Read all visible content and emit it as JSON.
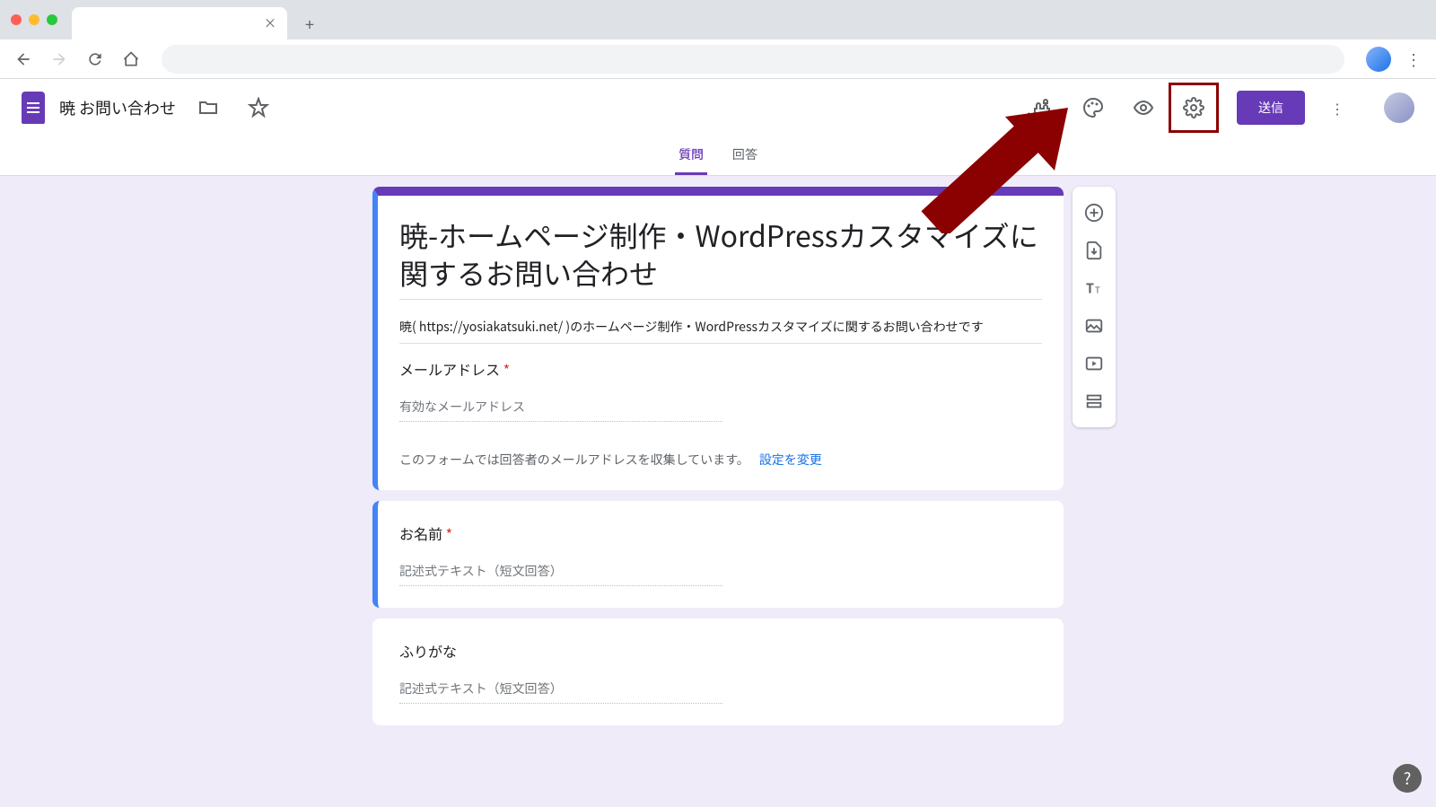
{
  "browser": {
    "tab_title": "",
    "tab_close": "×",
    "new_tab": "+"
  },
  "header": {
    "title": "暁 お問い合わせ",
    "send_label": "送信"
  },
  "tabs": {
    "questions": "質問",
    "responses": "回答"
  },
  "form": {
    "title": "暁-ホームページ制作・WordPressカスタマイズに関するお問い合わせ",
    "description": "暁( https://yosiakatsuki.net/ )のホームページ制作・WordPressカスタマイズに関するお問い合わせです",
    "email": {
      "label": "メールアドレス",
      "placeholder": "有効なメールアドレス",
      "note": "このフォームでは回答者のメールアドレスを収集しています。",
      "change_link": "設定を変更"
    },
    "questions": [
      {
        "label": "お名前",
        "required": true,
        "placeholder": "記述式テキスト（短文回答）"
      },
      {
        "label": "ふりがな",
        "required": false,
        "placeholder": "記述式テキスト（短文回答）"
      }
    ]
  },
  "help": "?"
}
